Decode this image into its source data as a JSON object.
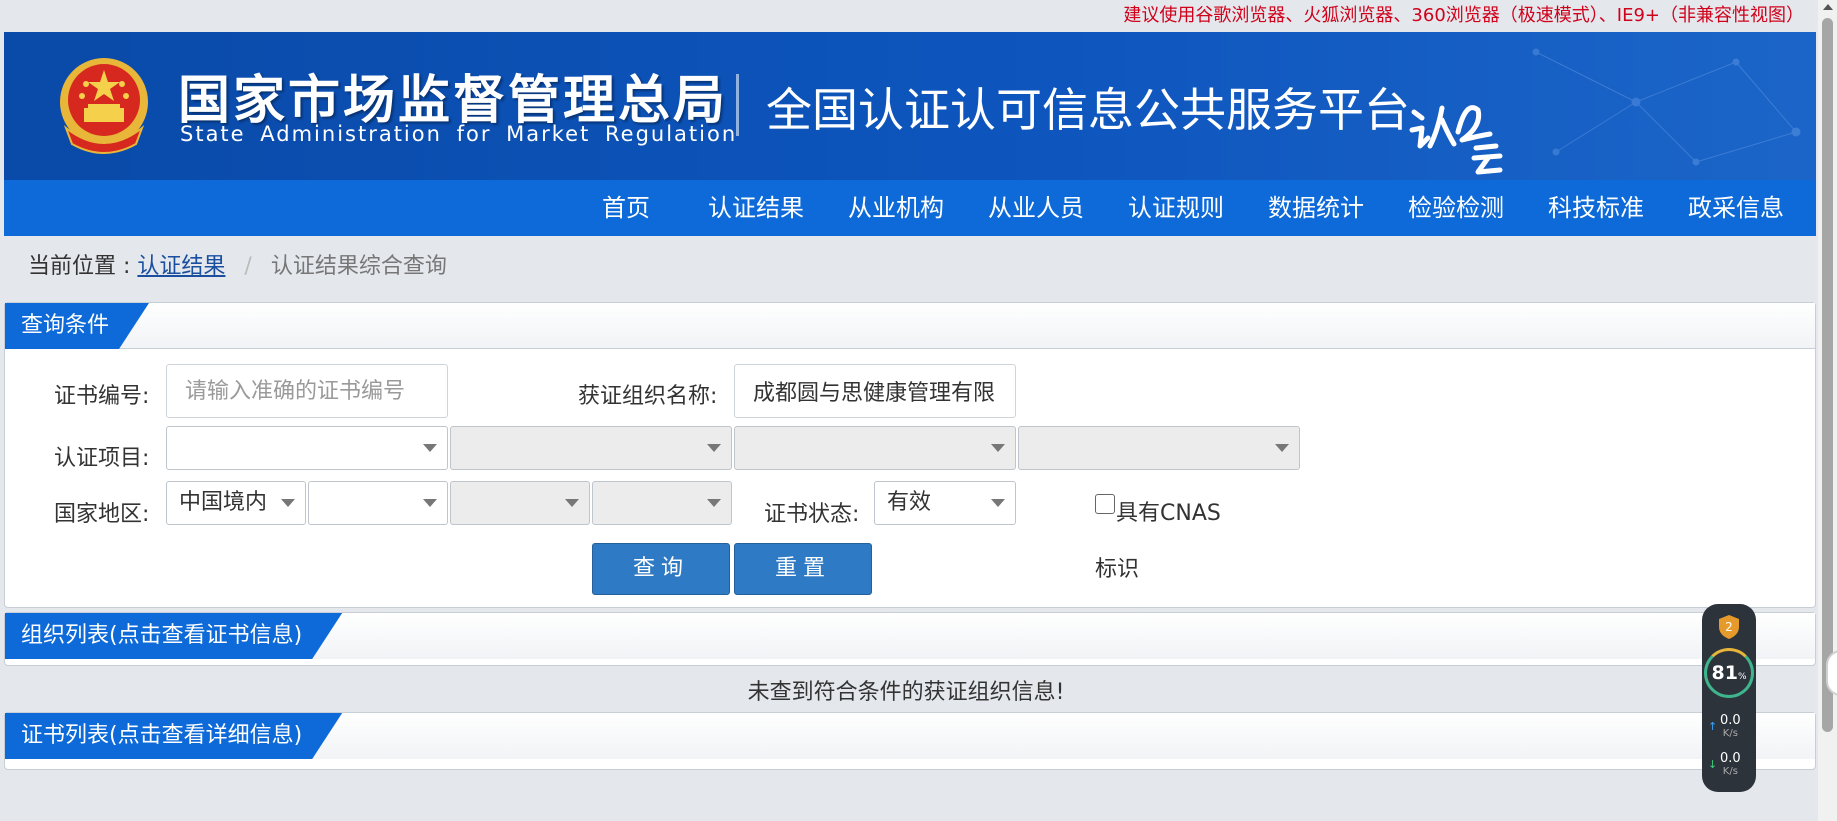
{
  "notice": "建议使用谷歌浏览器、火狐浏览器、360浏览器（极速模式）、IE9+（非兼容性视图）",
  "header": {
    "org_cn": "国家市场监督管理总局",
    "org_en": "State Administration for Market Regulation",
    "platform": "全国认证认可信息公共服务平台"
  },
  "nav": [
    "首页",
    "认证结果",
    "从业机构",
    "从业人员",
    "认证规则",
    "数据统计",
    "检验检测",
    "科技标准",
    "政采信息"
  ],
  "breadcrumb": {
    "label": "当前位置 :",
    "link": "认证结果",
    "separator": "/",
    "current": "认证结果综合查询"
  },
  "query": {
    "title": "查询条件",
    "cert_no_label": "证书编号:",
    "cert_no_placeholder": "请输入准确的证书编号",
    "org_name_label": "获证组织名称:",
    "org_name_value": "成都圆与思健康管理有限",
    "project_label": "认证项目:",
    "region_label": "国家地区:",
    "region_value": "中国境内",
    "status_label": "证书状态:",
    "status_value": "有效",
    "cnas_line1": "具有CNAS",
    "cnas_line2": "标识",
    "search_button": "查询",
    "reset_button": "重置"
  },
  "org_list": {
    "title": "组织列表(点击查看证书信息)",
    "empty_message": "未查到符合条件的获证组织信息!"
  },
  "cert_list": {
    "title": "证书列表(点击查看详细信息)"
  },
  "widget": {
    "badge": "2",
    "percent": "81",
    "percent_unit": "%",
    "up_speed": "0.0",
    "down_speed": "0.0",
    "speed_unit": "K/s"
  },
  "colors": {
    "banner": "#0d55bd",
    "nav": "#0d6ad8",
    "button": "#2f7ac4",
    "notice": "#d0021b"
  }
}
